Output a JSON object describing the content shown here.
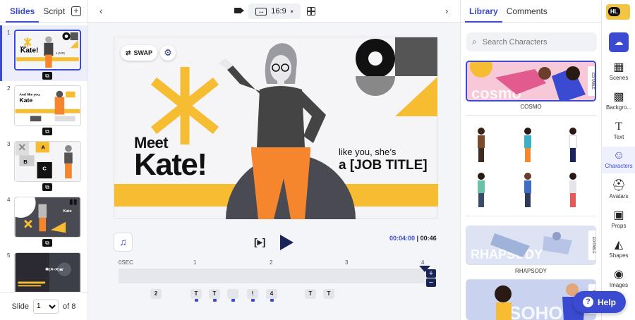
{
  "left_panel": {
    "tabs": [
      {
        "label": "Slides"
      },
      {
        "label": "Script"
      }
    ],
    "add_slide_icon": "plus-square-icon",
    "slides": [
      {
        "number": "1"
      },
      {
        "number": "2"
      },
      {
        "number": "3"
      },
      {
        "number": "4"
      },
      {
        "number": "5"
      }
    ],
    "pager": {
      "label": "Slide",
      "current": "1",
      "total_label": "of 8"
    }
  },
  "toolbar": {
    "prev_icon": "‹",
    "next_icon": "›",
    "aspect_ratio": "16:9",
    "camera_icon": "video-camera-icon",
    "grid_icon": "grid-icon"
  },
  "canvas": {
    "swap_label": "SWAP",
    "meet": "Meet",
    "name": "Kate!",
    "tagline": "like you, she’s",
    "job_title": "a [JOB TITLE]"
  },
  "player": {
    "frame_label": "[▸]",
    "current_time": "00:04:00",
    "total_time": "00:46"
  },
  "timeline": {
    "ruler": [
      "0SEC",
      "1",
      "2",
      "3",
      "4"
    ],
    "markers": [
      "2",
      "T",
      "T",
      "",
      "",
      "!",
      "4",
      "T",
      "T"
    ]
  },
  "library": {
    "tabs": [
      {
        "label": "Library"
      },
      {
        "label": "Comments"
      }
    ],
    "search_placeholder": "Search Characters",
    "cards": [
      {
        "label": "COSMO",
        "editable": "EDITABLE",
        "watermark": "cosmo"
      },
      {
        "label": "RHAPSODY",
        "editable": "EDITABLE",
        "watermark": "RHAPSODY"
      },
      {
        "label": "",
        "editable": "EDITABLE",
        "watermark": "SOHO"
      }
    ]
  },
  "rail": {
    "avatar_initials": "HL",
    "items": [
      {
        "label": "Scenes"
      },
      {
        "label": "Backgro..."
      },
      {
        "label": "Text"
      },
      {
        "label": "Characters"
      },
      {
        "label": "Avatars"
      },
      {
        "label": "Props"
      },
      {
        "label": "Shapes"
      },
      {
        "label": "Images"
      }
    ]
  },
  "help": {
    "label": "Help"
  },
  "colors": {
    "accent": "#3b4bd1",
    "yellow": "#f6bd33",
    "orange": "#f5862d",
    "dark": "#1a2458"
  }
}
